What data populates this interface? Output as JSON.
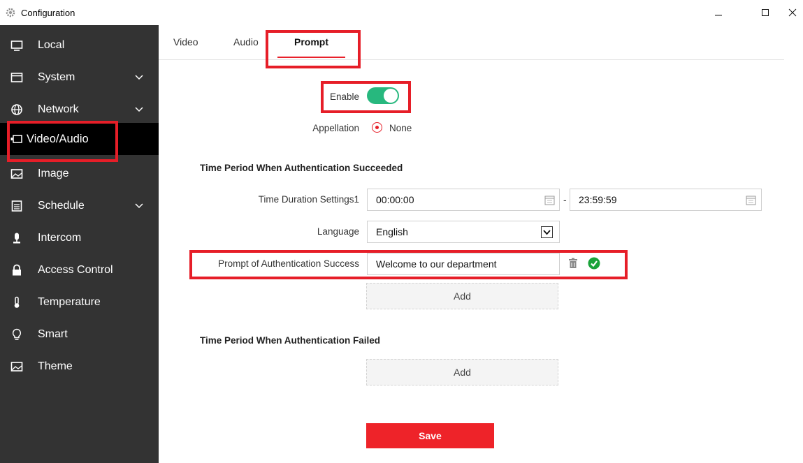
{
  "window": {
    "title": "Configuration"
  },
  "sidebar": {
    "items": [
      {
        "label": "Local",
        "icon": "monitor-icon"
      },
      {
        "label": "System",
        "icon": "window-icon",
        "expandable": true
      },
      {
        "label": "Network",
        "icon": "globe-icon",
        "expandable": true
      },
      {
        "label": "Video/Audio",
        "icon": "video-icon",
        "active": true
      },
      {
        "label": "Image",
        "icon": "image-icon"
      },
      {
        "label": "Schedule",
        "icon": "calendar-icon",
        "expandable": true
      },
      {
        "label": "Intercom",
        "icon": "microphone-icon"
      },
      {
        "label": "Access Control",
        "icon": "lock-icon"
      },
      {
        "label": "Temperature",
        "icon": "thermometer-icon"
      },
      {
        "label": "Smart",
        "icon": "lightbulb-icon"
      },
      {
        "label": "Theme",
        "icon": "image-icon"
      }
    ]
  },
  "tabs": {
    "video": "Video",
    "audio": "Audio",
    "prompt": "Prompt",
    "active": "Prompt"
  },
  "form": {
    "enable_label": "Enable",
    "enable_on": true,
    "appellation_label": "Appellation",
    "appellation_option": "None",
    "success_section_title": "Time Period When Authentication Succeeded",
    "time_duration_label": "Time Duration Settings1",
    "time_start": "00:00:00",
    "time_separator": "-",
    "time_end": "23:59:59",
    "language_label": "Language",
    "language_value": "English",
    "prompt_success_label": "Prompt of Authentication Success",
    "prompt_success_value": "Welcome to our department",
    "add_label": "Add",
    "failed_section_title": "Time Period When Authentication Failed",
    "add_failed_label": "Add",
    "save_label": "Save"
  },
  "colors": {
    "sidebar_bg": "#333333",
    "sidebar_active_bg": "#000000",
    "accent_red": "#e61e28",
    "toggle_green": "#27b87e",
    "success_green": "#1aa33a",
    "save_red": "#ee2329"
  }
}
